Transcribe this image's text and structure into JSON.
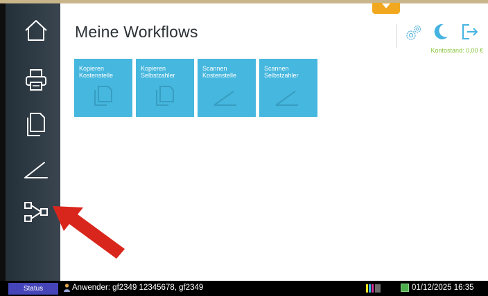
{
  "header": {
    "title": "Meine Workflows",
    "balance_label": "Kontostand: 0,00 €"
  },
  "icons": {
    "home": "home-icon",
    "print": "printer-icon",
    "copy": "copy-icon",
    "scan": "scanner-icon",
    "workflow": "workflow-icon",
    "settings": "gear-icon",
    "sleep": "moon-icon",
    "logout": "logout-icon"
  },
  "tiles": [
    {
      "label": "Kopieren\nKostenstelle",
      "icon": "copy-icon"
    },
    {
      "label": "Kopieren\nSelbstzahler",
      "icon": "copy-icon"
    },
    {
      "label": "Scannen\nKostenstelle",
      "icon": "scanner-icon"
    },
    {
      "label": "Scannen\nSelbstzahler",
      "icon": "scanner-icon"
    }
  ],
  "status_bar": {
    "status_label": "Status",
    "user_text": "Anwender: gf2349 12345678, gf2349",
    "datetime": "01/12/2025 16:35"
  },
  "colors": {
    "accent_tile": "#46b7de",
    "balance": "#8cc63f",
    "status_button": "#4545b9",
    "annotation_arrow": "#d9261c"
  }
}
